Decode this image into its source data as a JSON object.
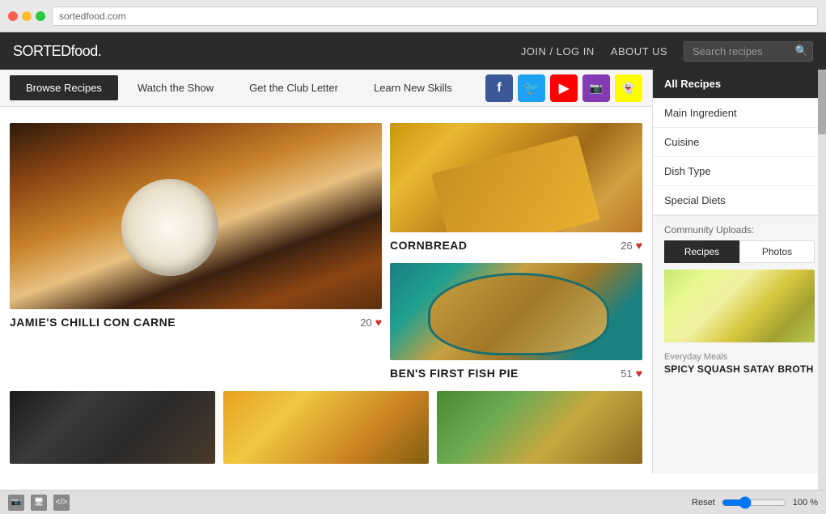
{
  "header": {
    "logo": "SORTEDfood.",
    "nav": {
      "join_login": "JOIN / LOG IN",
      "about_us": "ABOUT US"
    },
    "search_placeholder": "Search recipes"
  },
  "nav_bar": {
    "buttons": [
      {
        "label": "Browse Recipes",
        "active": true
      },
      {
        "label": "Watch the Show",
        "active": false
      },
      {
        "label": "Get the Club Letter",
        "active": false
      },
      {
        "label": "Learn New Skills",
        "active": false
      }
    ]
  },
  "social": {
    "icons": [
      {
        "name": "facebook",
        "symbol": "f"
      },
      {
        "name": "twitter",
        "symbol": "t"
      },
      {
        "name": "youtube",
        "symbol": "▶"
      },
      {
        "name": "instagram",
        "symbol": "◻"
      },
      {
        "name": "snapchat",
        "symbol": "👻"
      }
    ]
  },
  "recipes": {
    "featured": {
      "title": "JAMIE'S CHILLI CON CARNE",
      "likes": "20"
    },
    "cornbread": {
      "title": "CORNBREAD",
      "likes": "26"
    },
    "fishpie": {
      "title": "BEN'S FIRST FISH PIE",
      "likes": "51"
    }
  },
  "sidebar": {
    "menu_items": [
      {
        "label": "All Recipes",
        "active": true
      },
      {
        "label": "Main Ingredient",
        "active": false
      },
      {
        "label": "Cuisine",
        "active": false
      },
      {
        "label": "Dish Type",
        "active": false
      },
      {
        "label": "Special Diets",
        "active": false
      }
    ],
    "community": {
      "label": "Community Uploads:",
      "tabs": [
        {
          "label": "Recipes",
          "active": true
        },
        {
          "label": "Photos",
          "active": false
        }
      ],
      "featured_category": "Everyday Meals",
      "featured_title": "SPICY SQUASH SATAY BROTH"
    }
  },
  "toolbar": {
    "reset_label": "Reset",
    "zoom_value": "100",
    "zoom_unit": "%"
  }
}
